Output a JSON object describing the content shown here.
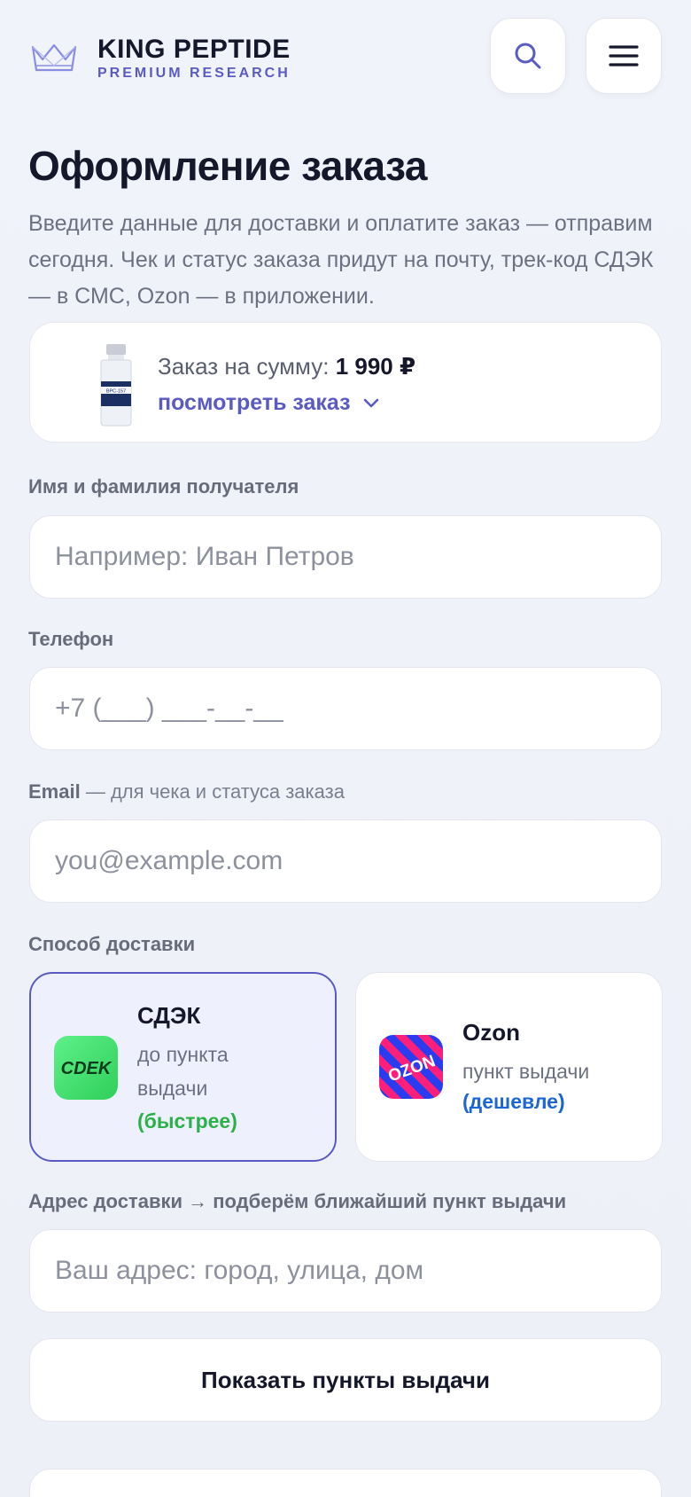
{
  "header": {
    "brand_title": "KING PEPTIDE",
    "brand_subtitle": "PREMIUM RESEARCH",
    "search_icon": "search-icon",
    "menu_icon": "hamburger-icon"
  },
  "page": {
    "title": "Оформление заказа",
    "subtitle": "Введите данные для доставки и оплатите заказ — отправим сегодня. Чек и статус заказа придут на почту, трек-код СДЭК — в СМС, Ozon — в приложении."
  },
  "order": {
    "sum_label": "Заказ на сумму:",
    "sum_value": "1 990 ₽",
    "view_link": "посмотреть заказ",
    "product_label": "BPC-157"
  },
  "form": {
    "name_label": "Имя и фамилия получателя",
    "name_placeholder": "Например: Иван Петров",
    "phone_label": "Телефон",
    "phone_placeholder": "+7 (___) ___-__-__",
    "email_label": "Email",
    "email_hint": "— для чека и статуса заказа",
    "email_placeholder": "you@example.com",
    "delivery_label": "Способ доставки",
    "address_label": "Адрес доставки → подберём ближайший пункт выдачи",
    "address_placeholder": "Ваш адрес: город, улица, дом",
    "show_points_button": "Показать пункты выдачи"
  },
  "delivery_options": [
    {
      "name": "СДЭК",
      "desc": "до пункта выдачи",
      "badge": "(быстрее)",
      "logo_text": "CDEK",
      "badge_color": "#2bb04a",
      "selected": true
    },
    {
      "name": "Ozon",
      "desc": "пункт выдачи",
      "badge": "(дешевле)",
      "logo_text": "OZON",
      "badge_color": "#1a66d6",
      "selected": false
    }
  ],
  "colors": {
    "accent": "#5a5bc2",
    "cdek_green": "#3fdc6a",
    "ozon_blue": "#2a3cf0",
    "ozon_pink": "#ff1f7a"
  }
}
